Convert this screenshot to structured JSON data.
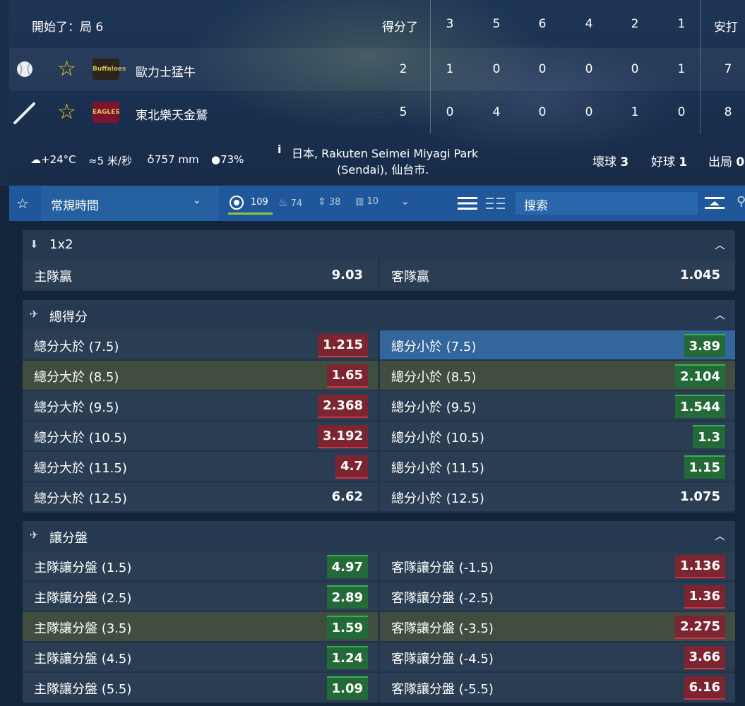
{
  "scoreboard": {
    "status": "開始了：局 6",
    "score_label": "得分了",
    "innings": [
      "3",
      "5",
      "6",
      "4",
      "2",
      "1"
    ],
    "hits_label": "安打",
    "teams": [
      {
        "role": "batting-ball",
        "name": "歐力士猛牛",
        "logo_text": "Buffaloes",
        "score": "2",
        "innings": [
          "1",
          "0",
          "0",
          "0",
          "0",
          "1"
        ],
        "hits": "7"
      },
      {
        "role": "bat",
        "name": "東北樂天金鷲",
        "logo_text": "EAGLES",
        "score": "5",
        "innings": [
          "0",
          "4",
          "0",
          "0",
          "1",
          "0"
        ],
        "hits": "8"
      }
    ],
    "weather": {
      "temp": "+24°C",
      "wind": "5 米/秒",
      "pressure": "757 mm",
      "humidity": "73%"
    },
    "venue_line1": "日本, Rakuten Seimei Miyagi Park",
    "venue_line2": "(Sendai), 仙台市.",
    "balls_label": "壞球",
    "balls": "3",
    "strikes_label": "好球",
    "strikes": "1",
    "outs_label": "出局",
    "outs": "0"
  },
  "toolbar": {
    "period": "常規時間",
    "counts": {
      "all": "109",
      "hot": "74",
      "updown": "38",
      "stats": "10"
    },
    "search_placeholder": "搜索"
  },
  "markets": [
    {
      "title": "1x2",
      "rows": [
        [
          {
            "label": "主隊贏",
            "odd": "9.03",
            "style": "plain"
          },
          {
            "label": "客隊贏",
            "odd": "1.045",
            "style": "plain"
          }
        ]
      ]
    },
    {
      "title": "總得分",
      "rows": [
        [
          {
            "label": "總分大於 (7.5)",
            "odd": "1.215",
            "style": "red"
          },
          {
            "label": "總分小於 (7.5)",
            "odd": "3.89",
            "style": "green"
          }
        ],
        [
          {
            "label": "總分大於 (8.5)",
            "odd": "1.65",
            "style": "red"
          },
          {
            "label": "總分小於 (8.5)",
            "odd": "2.104",
            "style": "green"
          }
        ],
        [
          {
            "label": "總分大於 (9.5)",
            "odd": "2.368",
            "style": "red"
          },
          {
            "label": "總分小於 (9.5)",
            "odd": "1.544",
            "style": "green"
          }
        ],
        [
          {
            "label": "總分大於 (10.5)",
            "odd": "3.192",
            "style": "red"
          },
          {
            "label": "總分小於 (10.5)",
            "odd": "1.3",
            "style": "green"
          }
        ],
        [
          {
            "label": "總分大於 (11.5)",
            "odd": "4.7",
            "style": "red"
          },
          {
            "label": "總分小於 (11.5)",
            "odd": "1.15",
            "style": "green"
          }
        ],
        [
          {
            "label": "總分大於 (12.5)",
            "odd": "6.62",
            "style": "plain"
          },
          {
            "label": "總分小於 (12.5)",
            "odd": "1.075",
            "style": "plain"
          }
        ]
      ]
    },
    {
      "title": "讓分盤",
      "rows": [
        [
          {
            "label": "主隊讓分盤 (1.5)",
            "odd": "4.97",
            "style": "green"
          },
          {
            "label": "客隊讓分盤 (-1.5)",
            "odd": "1.136",
            "style": "red"
          }
        ],
        [
          {
            "label": "主隊讓分盤 (2.5)",
            "odd": "2.89",
            "style": "green"
          },
          {
            "label": "客隊讓分盤 (-2.5)",
            "odd": "1.36",
            "style": "red"
          }
        ],
        [
          {
            "label": "主隊讓分盤 (3.5)",
            "odd": "1.59",
            "style": "green"
          },
          {
            "label": "客隊讓分盤 (-3.5)",
            "odd": "2.275",
            "style": "red"
          }
        ],
        [
          {
            "label": "主隊讓分盤 (4.5)",
            "odd": "1.24",
            "style": "green"
          },
          {
            "label": "客隊讓分盤 (-4.5)",
            "odd": "3.66",
            "style": "red"
          }
        ],
        [
          {
            "label": "主隊讓分盤 (5.5)",
            "odd": "1.09",
            "style": "green"
          },
          {
            "label": "客隊讓分盤 (-5.5)",
            "odd": "6.16",
            "style": "red"
          }
        ]
      ]
    }
  ],
  "colors": {
    "accent_blue": "#20579a",
    "odd_up_green": "#35b24f",
    "odd_down_red": "#d23347",
    "star_yellow": "#f5c518"
  }
}
